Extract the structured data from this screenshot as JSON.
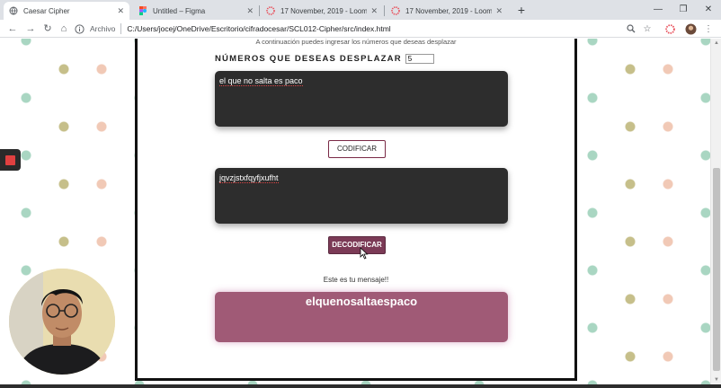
{
  "tabs": [
    {
      "title": "Caesar Cipher",
      "active": true
    },
    {
      "title": "Untitled – Figma",
      "active": false
    },
    {
      "title": "17 November, 2019 - Loom Recor",
      "active": false
    },
    {
      "title": "17 November, 2019 - Loom Reco",
      "active": false
    }
  ],
  "toolbar": {
    "scheme": "Archivo",
    "url": "C:/Users/jocej/OneDrive/Escritorio/cifradocesar/SCL012-Cipher/src/index.html"
  },
  "page": {
    "hint": "A continuación puedes ingresar los números que deseas desplazar",
    "shift_label": "NÚMEROS QUE DESEAS DESPLAZAR",
    "shift_value": "5",
    "input_text": "el que no salta es paco",
    "encode_label": "CODIFICAR",
    "encoded_text": "jqvzjstxfqyfjxufht",
    "decode_label": "DECODIFICAR",
    "message_label": "Este es tu mensaje!!",
    "result_text": "elquenosaltaespaco"
  },
  "colors": {
    "accent": "#7b3a56",
    "result_bg": "#a05a76",
    "textbox_bg": "#2d2d2d"
  },
  "icons": [
    "chrome-globe-icon",
    "figma-icon",
    "loom-icon",
    "back-arrow-icon",
    "forward-arrow-icon",
    "reload-icon",
    "home-icon",
    "info-icon",
    "zoom-icon",
    "star-icon",
    "profile-avatar-icon",
    "menu-icon",
    "record-stop-icon"
  ]
}
